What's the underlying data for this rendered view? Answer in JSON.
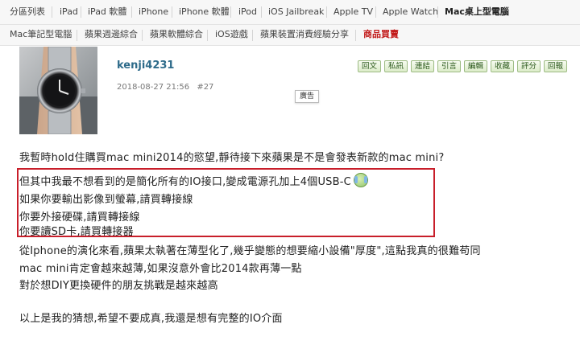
{
  "nav_primary": [
    {
      "label": "分區列表"
    },
    {
      "label": "iPad"
    },
    {
      "label": "iPad 軟體"
    },
    {
      "label": "iPhone"
    },
    {
      "label": "iPhone 軟體"
    },
    {
      "label": "iPod"
    },
    {
      "label": "iOS Jailbreak"
    },
    {
      "label": "Apple TV"
    },
    {
      "label": "Apple Watch"
    },
    {
      "label": "Mac桌上型電腦"
    }
  ],
  "nav_secondary": [
    {
      "label": "Mac筆記型電腦"
    },
    {
      "label": "蘋果週邊綜合"
    },
    {
      "label": "蘋果軟體綜合"
    },
    {
      "label": "iOS遊戲"
    },
    {
      "label": "蘋果裝置消費經驗分享"
    },
    {
      "label": "商品買賣"
    }
  ],
  "post": {
    "username": "kenji4231",
    "date": "2018-08-27 21:56",
    "floor": "#27",
    "ad_label": "廣告",
    "actions": [
      "回文",
      "私訊",
      "連結",
      "引言",
      "編輯",
      "收藏",
      "評分",
      "回報"
    ],
    "lines": [
      "我暫時hold住購買mac mini2014的慾望,靜待接下來蘋果是不是會發表新款的mac mini?",
      "但其中我最不想看到的是簡化所有的IO接口,變成電源孔加上4個USB-C",
      "如果你要輸出影像到螢幕,請買轉接線",
      "你要外接硬碟,請買轉接線",
      "你要讀SD卡,請買轉接器",
      "從Iphone的演化來看,蘋果太執著在薄型化了,幾乎變態的想要縮小設備\"厚度\",這點我真的很難苟同",
      "mac mini肯定會越來越薄,如果沒意外會比2014款再薄一點",
      "對於想DIY更換硬件的朋友挑戰是越來越高",
      "以上是我的猜想,希望不要成真,我還是想有完整的IO介面"
    ]
  },
  "colors": {
    "highlight_box": "#c81e2a",
    "username": "#2e6b8a",
    "hot_link": "#c21a1a"
  }
}
